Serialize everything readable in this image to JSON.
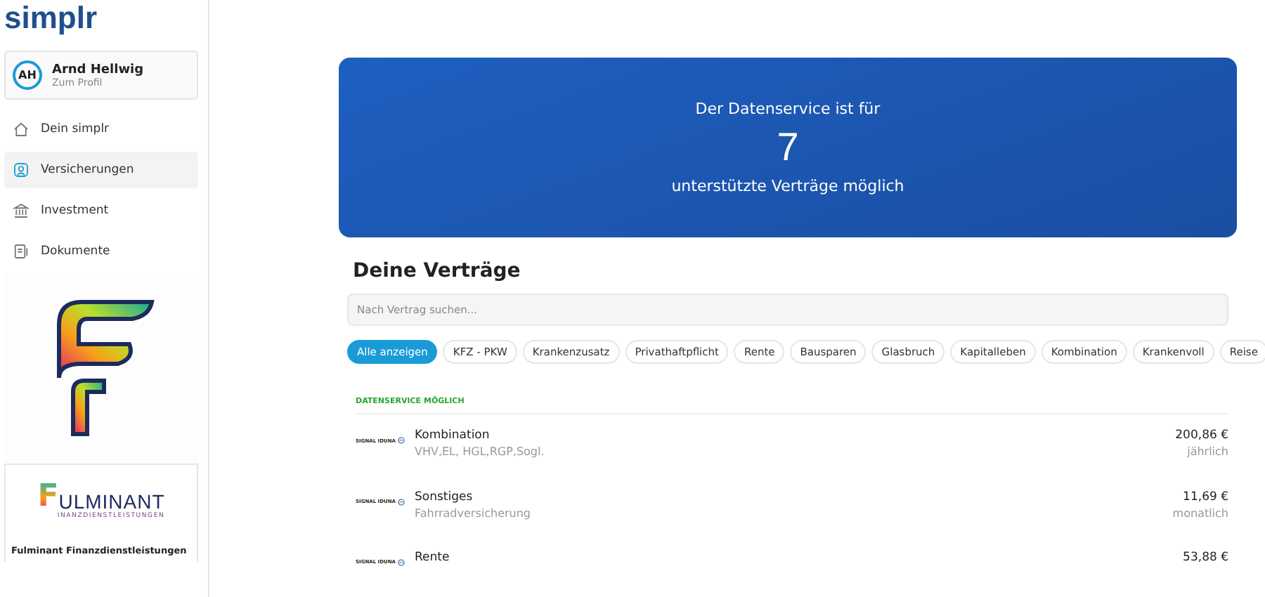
{
  "brand": "simplr",
  "profile": {
    "initials": "AH",
    "name": "Arnd Hellwig",
    "link": "Zum Profil"
  },
  "nav": [
    {
      "label": "Dein simplr",
      "kind": "home",
      "selected": false
    },
    {
      "label": "Versicherungen",
      "kind": "person",
      "selected": true
    },
    {
      "label": "Investment",
      "kind": "bank",
      "selected": false
    },
    {
      "label": "Dokumente",
      "kind": "doc",
      "selected": false
    }
  ],
  "partner": {
    "logo_letter": "F",
    "logo_word": "ULMINANT",
    "logo_sub": "INANZDIENSTLEISTUNGEN",
    "name": "Fulminant Finanzdienstleistungen"
  },
  "banner": {
    "line1": "Der Datenservice ist für",
    "count": "7",
    "line2": "unterstützte Verträge möglich"
  },
  "heading": "Deine Verträge",
  "search": {
    "placeholder": "Nach Vertrag suchen..."
  },
  "filters": [
    {
      "label": "Alle anzeigen",
      "selected": true
    },
    {
      "label": "KFZ - PKW",
      "selected": false
    },
    {
      "label": "Krankenzusatz",
      "selected": false
    },
    {
      "label": "Privathaftpflicht",
      "selected": false
    },
    {
      "label": "Rente",
      "selected": false
    },
    {
      "label": "Bausparen",
      "selected": false
    },
    {
      "label": "Glasbruch",
      "selected": false
    },
    {
      "label": "Kapitalleben",
      "selected": false
    },
    {
      "label": "Kombination",
      "selected": false
    },
    {
      "label": "Krankenvoll",
      "selected": false
    },
    {
      "label": "Reise",
      "selected": false
    }
  ],
  "section_label": "DATENSERVICE MÖGLICH",
  "contracts": [
    {
      "insurer": "SIGNAL IDUNA",
      "title": "Kombination",
      "detail": "VHV,EL, HGL,RGP,Sogl.",
      "amount": "200,86 €",
      "period": "jährlich"
    },
    {
      "insurer": "SIGNAL IDUNA",
      "title": "Sonstiges",
      "detail": "Fahrradversicherung",
      "amount": "11,69 €",
      "period": "monatlich"
    },
    {
      "insurer": "SIGNAL IDUNA",
      "title": "Rente",
      "amount": "53,88 €"
    }
  ]
}
